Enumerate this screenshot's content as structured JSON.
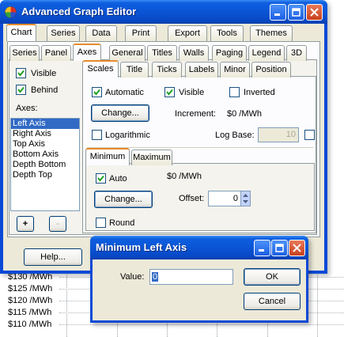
{
  "window": {
    "title": "Advanced Graph Editor",
    "main_tabs": [
      "Chart",
      "Series",
      "Data",
      "Print",
      "Export",
      "Tools",
      "Themes"
    ],
    "sub_tabs": [
      "Series",
      "Panel",
      "Axes",
      "General",
      "Titles",
      "Walls",
      "Paging",
      "Legend",
      "3D"
    ],
    "axes_tabs": [
      "Scales",
      "Title",
      "Ticks",
      "Labels",
      "Minor",
      "Position"
    ],
    "left_panel": {
      "visible_label": "Visible",
      "behind_label": "Behind",
      "axes_heading": "Axes:",
      "axes_list": [
        "Left Axis",
        "Right Axis",
        "Top Axis",
        "Bottom Axis",
        "Depth Bottom",
        "Depth Top"
      ],
      "add_label": "+",
      "remove_label": "-"
    },
    "scales": {
      "automatic_label": "Automatic",
      "visible_label": "Visible",
      "inverted_label": "Inverted",
      "change_label": "Change...",
      "increment_label": "Increment:",
      "increment_value": "$0 /MWh",
      "logarithmic_label": "Logarithmic",
      "log_base_label": "Log Base:",
      "log_base_value": "10",
      "minmax_tabs": [
        "Minimum",
        "Maximum"
      ],
      "auto_label": "Auto",
      "min_value": "$0 /MWh",
      "min_change_label": "Change...",
      "offset_label": "Offset:",
      "offset_value": "0",
      "round_label": "Round"
    },
    "help_label": "Help..."
  },
  "dialog": {
    "title": "Minimum Left Axis",
    "value_label": "Value:",
    "value": "0",
    "ok_label": "OK",
    "cancel_label": "Cancel"
  },
  "background_chart": {
    "y_labels": [
      "$130 /MWh",
      "$125 /MWh",
      "$120 /MWh",
      "$115 /MWh",
      "$110 /MWh"
    ]
  },
  "colors": {
    "xp_blue": "#0a49d6",
    "tab_highlight": "#e68b2c",
    "selection": "#316ac5",
    "close_button": "#c8401c"
  }
}
